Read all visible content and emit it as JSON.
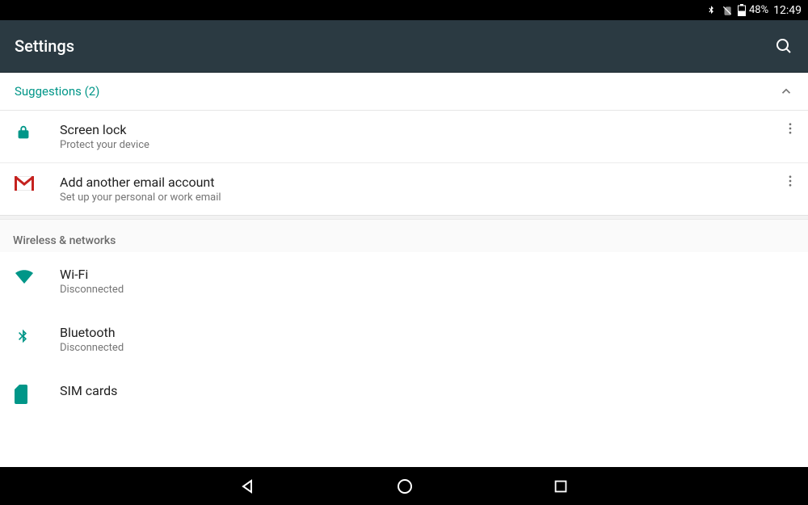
{
  "status": {
    "battery_pct": "48%",
    "time": "12:49"
  },
  "header": {
    "title": "Settings"
  },
  "suggestions": {
    "label": "Suggestions (2)",
    "items": [
      {
        "title": "Screen lock",
        "subtitle": "Protect your device"
      },
      {
        "title": "Add another email account",
        "subtitle": "Set up your personal or work email"
      }
    ]
  },
  "sections": {
    "wireless": {
      "label": "Wireless & networks",
      "items": [
        {
          "title": "Wi-Fi",
          "subtitle": "Disconnected"
        },
        {
          "title": "Bluetooth",
          "subtitle": "Disconnected"
        },
        {
          "title": "SIM cards",
          "subtitle": ""
        }
      ]
    }
  },
  "colors": {
    "accent": "#009688",
    "appbar": "#2b3a42"
  }
}
